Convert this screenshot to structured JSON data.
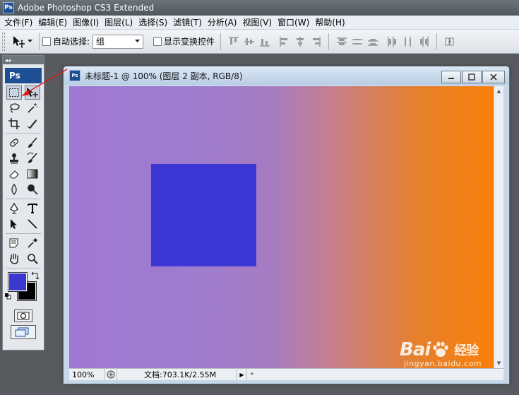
{
  "app": {
    "title": "Adobe Photoshop CS3 Extended",
    "logo": "Ps"
  },
  "menu": {
    "items": [
      {
        "label": "文件(F)"
      },
      {
        "label": "编辑(E)"
      },
      {
        "label": "图像(I)"
      },
      {
        "label": "图层(L)"
      },
      {
        "label": "选择(S)"
      },
      {
        "label": "滤镜(T)"
      },
      {
        "label": "分析(A)"
      },
      {
        "label": "视图(V)"
      },
      {
        "label": "窗口(W)"
      },
      {
        "label": "帮助(H)"
      }
    ]
  },
  "options": {
    "auto_select_label": "自动选择:",
    "auto_select_value": "组",
    "show_transform_label": "显示变换控件"
  },
  "toolbox": {
    "logo": "Ps",
    "foreground_color": "#3b38d1",
    "background_color": "#000000"
  },
  "document": {
    "title": "未标题-1 @ 100% (图层 2 副本, RGB/8)",
    "zoom": "100%",
    "doc_info": "文档:703.1K/2.55M",
    "gradient_start": "#9f78d4",
    "gradient_end": "#f97f0a",
    "square_color": "#3c37d4"
  },
  "watermark": {
    "logo_left": "Bai",
    "logo_right": "经验",
    "url": "jingyan.baidu.com"
  }
}
